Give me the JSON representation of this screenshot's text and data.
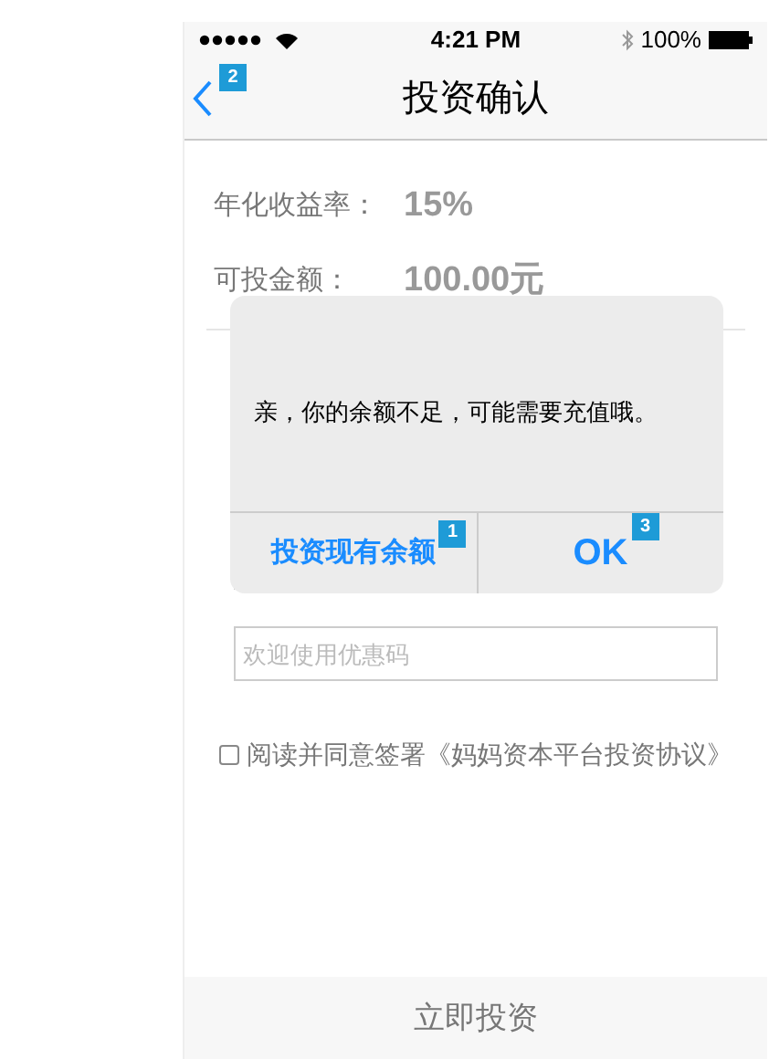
{
  "status_bar": {
    "time": "4:21 PM",
    "battery": "100%"
  },
  "nav": {
    "title": "投资确认",
    "back_badge": "2"
  },
  "info": [
    {
      "label": "年化收益率：",
      "value": "15%"
    },
    {
      "label": "可投金额：",
      "value": "100.00元"
    }
  ],
  "coupon_field": {
    "placeholder": "欢迎使用优惠码"
  },
  "agreement": {
    "text": "阅读并同意签署《妈妈资本平台投资协议》",
    "checked": false
  },
  "submit": "立即投资",
  "alert": {
    "message": "亲，你的余额不足，可能需要充值哦。",
    "buttons": [
      {
        "label": "投资现有余额",
        "badge": "1",
        "bold": false
      },
      {
        "label": "OK",
        "badge": "3",
        "bold": true
      }
    ]
  }
}
